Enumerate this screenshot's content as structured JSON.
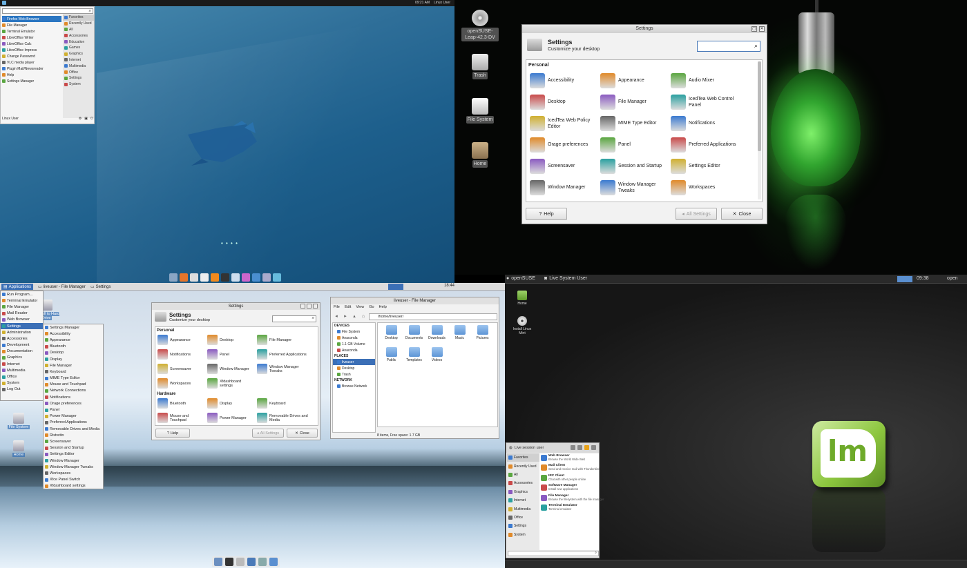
{
  "q1": {
    "topbar": {
      "time": "09:21 AM",
      "user": "Linux User"
    },
    "menu": {
      "apps": [
        "Firefox Web Browser",
        "File Manager",
        "Terminal Emulator",
        "LibreOffice Writer",
        "LibreOffice Calc",
        "LibreOffice Impress",
        "Change Password",
        "VLC media player",
        "Plugin Mail/Newsreader",
        "Help",
        "Settings Manager"
      ],
      "categories": [
        "Favorites",
        "Recently Used",
        "All",
        "Accessories",
        "Education",
        "Games",
        "Graphics",
        "Internet",
        "Multimedia",
        "Office",
        "Settings",
        "System"
      ],
      "user": "Linux User"
    },
    "loading": "• • • •"
  },
  "q2": {
    "desktop_icons": [
      "openSUSE-Leap-42.3-DV",
      "Trash",
      "File System",
      "Home"
    ],
    "settings": {
      "window_title": "Settings",
      "title": "Settings",
      "subtitle": "Customize your desktop",
      "section": "Personal",
      "items": [
        "Accessibility",
        "Appearance",
        "Audio Mixer",
        "Desktop",
        "File Manager",
        "IcedTea Web Control Panel",
        "IcedTea Web Policy Editor",
        "MIME Type Editor",
        "Notifications",
        "Orage preferences",
        "Panel",
        "Preferred Applications",
        "Screensaver",
        "Session and Startup",
        "Settings Editor",
        "Window Manager",
        "Window Manager Tweaks",
        "Workspaces"
      ],
      "help": "Help",
      "all_settings": "All Settings",
      "close": "Close"
    }
  },
  "q3": {
    "panel": {
      "applications": "Applications",
      "task1": "liveuser - File Manager",
      "task2": "Settings",
      "clock": "18:44"
    },
    "menu": [
      "Run Program...",
      "Terminal Emulator",
      "File Manager",
      "Mail Reader",
      "Web Browser",
      "Settings",
      "Administration",
      "Accessories",
      "Development",
      "Documentation",
      "Graphics",
      "Internet",
      "Multimedia",
      "Office",
      "System",
      "Log Out"
    ],
    "submenu": [
      "Settings Manager",
      "Accessibility",
      "Appearance",
      "Bluetooth",
      "Desktop",
      "Display",
      "File Manager",
      "Keyboard",
      "MIME Type Editor",
      "Mouse and Touchpad",
      "Network Connections",
      "Notifications",
      "Orage preferences",
      "Panel",
      "Power Manager",
      "Preferred Applications",
      "Removable Drives and Media",
      "Ristretto",
      "Screensaver",
      "Session and Startup",
      "Settings Editor",
      "Window Manager",
      "Window Manager Tweaks",
      "Workspaces",
      "Xfce Panel Switch",
      "Xfdashboard settings"
    ],
    "desktop_icons": [
      "Install to Hard Drive",
      "File System",
      "Home"
    ],
    "settings": {
      "window_title": "Settings",
      "title": "Settings",
      "subtitle": "Customize your desktop",
      "section_personal": "Personal",
      "personal": [
        "Appearance",
        "Desktop",
        "File Manager",
        "Notifications",
        "Panel",
        "Preferred Applications",
        "Screensaver",
        "Window Manager",
        "Window Manager Tweaks",
        "Workspaces",
        "Xfdashboard settings"
      ],
      "section_hardware": "Hardware",
      "hardware": [
        "Bluetooth",
        "Display",
        "Keyboard",
        "Mouse and Touchpad",
        "Power Manager",
        "Removable Drives and Media"
      ],
      "help": "Help",
      "all_settings": "All Settings",
      "close": "Close"
    },
    "filemanager": {
      "window_title": "liveuser - File Manager",
      "menu": [
        "File",
        "Edit",
        "View",
        "Go",
        "Help"
      ],
      "path": "/home/liveuser/",
      "devices_header": "DEVICES",
      "devices": [
        "File System",
        "Anaconda",
        "1.1 GB Volume",
        "Anaconda"
      ],
      "places_header": "PLACES",
      "places": [
        "liveuser",
        "Desktop",
        "Trash"
      ],
      "network_header": "NETWORK",
      "network": [
        "Browse Network"
      ],
      "folders": [
        "Desktop",
        "Documents",
        "Downloads",
        "Music",
        "Pictures",
        "Public",
        "Templates",
        "Videos"
      ],
      "status": "8 items, Free space: 1.7 GB"
    }
  },
  "q4": {
    "topbar": {
      "brand": "openSUSE",
      "user": "Live System User",
      "task": "Settings",
      "clock": "09:38",
      "extra": "open"
    },
    "desktop_icons": [
      "Home",
      "Install Linux Mint"
    ],
    "menu": {
      "user": "Live session user",
      "categories": [
        "Favorites",
        "Recently Used",
        "All",
        "Accessories",
        "Graphics",
        "Internet",
        "Multimedia",
        "Office",
        "Settings",
        "System"
      ],
      "apps": [
        {
          "name": "Web Browser",
          "desc": "Browse the World Wide Web"
        },
        {
          "name": "Mail Client",
          "desc": "Send and receive mail with Thunderbird"
        },
        {
          "name": "IRC Client",
          "desc": "Chat with other people online"
        },
        {
          "name": "Software Manager",
          "desc": "Install new applications"
        },
        {
          "name": "File Manager",
          "desc": "Browse the filesystem with the file manager"
        },
        {
          "name": "Terminal Emulator",
          "desc": "Terminal emulator"
        }
      ]
    }
  }
}
